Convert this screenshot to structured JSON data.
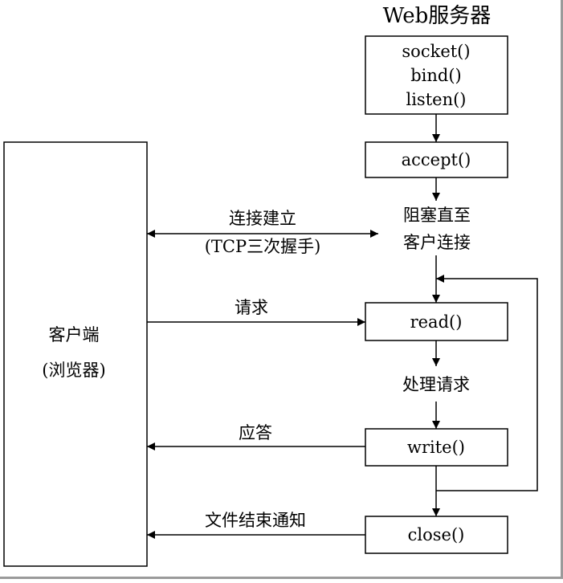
{
  "server": {
    "title": "Web服务器",
    "init_lines": [
      "socket()",
      "bind()",
      "listen()"
    ],
    "accept": "accept()",
    "block_lines": [
      "阻塞直至",
      "客户连接"
    ],
    "read": "read()",
    "process": "处理请求",
    "write": "write()",
    "close": "close()"
  },
  "client": {
    "lines": [
      "客户端",
      "(浏览器)"
    ]
  },
  "arrows": {
    "connect_lines": [
      "连接建立",
      "(TCP三次握手)"
    ],
    "request": "请求",
    "response": "应答",
    "eof": "文件结束通知"
  }
}
